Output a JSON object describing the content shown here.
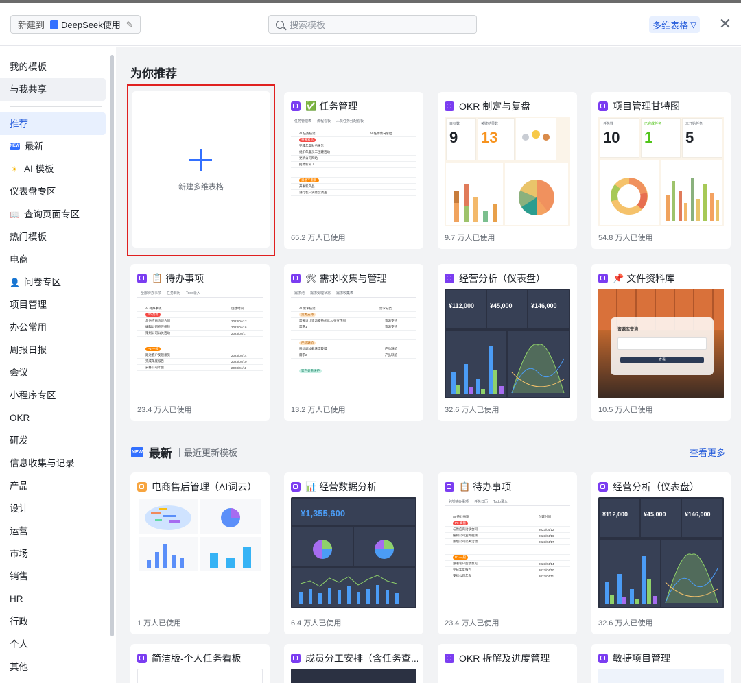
{
  "header": {
    "new_to_label": "新建到",
    "doc_name": "DeepSeek使用",
    "search_placeholder": "搜索模板",
    "filter_label": "多维表格"
  },
  "sidebar": {
    "top_items": [
      "我的模板",
      "与我共享"
    ],
    "items": [
      {
        "label": "推荐",
        "icon": ""
      },
      {
        "label": "最新",
        "icon": "new-badge-icon"
      },
      {
        "label": "AI 模板",
        "icon": "sparkle-icon"
      },
      {
        "label": "仪表盘专区",
        "icon": ""
      },
      {
        "label": "查询页面专区",
        "icon": "book-icon"
      },
      {
        "label": "热门模板",
        "icon": ""
      },
      {
        "label": "电商",
        "icon": ""
      },
      {
        "label": "问卷专区",
        "icon": "person-icon"
      },
      {
        "label": "项目管理",
        "icon": ""
      },
      {
        "label": "办公常用",
        "icon": ""
      },
      {
        "label": "周报日报",
        "icon": ""
      },
      {
        "label": "会议",
        "icon": ""
      },
      {
        "label": "小程序专区",
        "icon": ""
      },
      {
        "label": "OKR",
        "icon": ""
      },
      {
        "label": "研发",
        "icon": ""
      },
      {
        "label": "信息收集与记录",
        "icon": ""
      },
      {
        "label": "产品",
        "icon": ""
      },
      {
        "label": "设计",
        "icon": ""
      },
      {
        "label": "运营",
        "icon": ""
      },
      {
        "label": "市场",
        "icon": ""
      },
      {
        "label": "销售",
        "icon": ""
      },
      {
        "label": "HR",
        "icon": ""
      },
      {
        "label": "行政",
        "icon": ""
      },
      {
        "label": "个人",
        "icon": ""
      },
      {
        "label": "其他",
        "icon": ""
      }
    ]
  },
  "recommend": {
    "title": "为你推荐",
    "new_label": "新建多维表格",
    "cards": [
      {
        "title": "任务管理",
        "emoji": "✅",
        "usage": "65.2 万人已使用"
      },
      {
        "title": "OKR 制定与复盘",
        "emoji": "",
        "usage": "9.7 万人已使用"
      },
      {
        "title": "项目管理甘特图",
        "emoji": "",
        "usage": "54.8 万人已使用"
      },
      {
        "title": "待办事项",
        "emoji": "📋",
        "usage": "23.4 万人已使用"
      },
      {
        "title": "需求收集与管理",
        "emoji": "🛠",
        "usage": "13.2 万人已使用"
      },
      {
        "title": "经营分析（仪表盘）",
        "emoji": "",
        "usage": "32.6 万人已使用"
      },
      {
        "title": "文件资料库",
        "emoji": "📌",
        "usage": "10.5 万人已使用"
      }
    ]
  },
  "latest": {
    "title": "最新",
    "badge": "NEW",
    "subtitle": "最近更新模板",
    "more": "查看更多",
    "cards": [
      {
        "title": "电商售后管理（AI词云）",
        "emoji": "",
        "usage": "1 万人已使用"
      },
      {
        "title": "经营数据分析",
        "emoji": "📊",
        "usage": "6.4 万人已使用"
      },
      {
        "title": "待办事项",
        "emoji": "📋",
        "usage": "23.4 万人已使用"
      },
      {
        "title": "经营分析（仪表盘）",
        "emoji": "",
        "usage": "32.6 万人已使用"
      }
    ],
    "row3": [
      {
        "title": "简洁版-个人任务看板"
      },
      {
        "title": "成员分工安排（含任务查..."
      },
      {
        "title": "OKR 拆解及进度管理"
      },
      {
        "title": "敏捷项目管理"
      }
    ]
  },
  "previews": {
    "task_tabs": [
      "任务管理表",
      "流程看板",
      "人员任务分配看板"
    ],
    "task_col1": "AI 任务描述",
    "task_col2": "AI 任务情况总结",
    "task_group1": "重要紧急",
    "task_group2": "紧急不重要",
    "task_rows1": [
      "完成年度财务报告",
      "组织年度员工团建活动",
      "更新公司网站",
      "招聘新员工"
    ],
    "task_rows2": [
      "开发新产品",
      "进行客户满意度调查"
    ],
    "okr_stats": [
      {
        "label": "目标数",
        "value": "9"
      },
      {
        "label": "关键结果数",
        "value": "13"
      }
    ],
    "gantt_stats": [
      {
        "label": "任务数",
        "value": "10"
      },
      {
        "label": "已完成任务",
        "value": "1"
      },
      {
        "label": "未开始任务",
        "value": "5"
      }
    ],
    "todo_tabs": [
      "全部待办事项",
      "任务日历",
      "Todo录入"
    ],
    "todo_col1": "AI 待办事项",
    "todo_col2": "创建时间",
    "todo_group1": "P0-高优",
    "todo_group2": "P1-一般",
    "todo_rows1": [
      [
        "与供应商洽谈合同",
        "2023/04/12"
      ],
      [
        "编辑公司宣传视频",
        "2023/04/16"
      ],
      [
        "策划公司公关活动",
        "2023/04/17"
      ]
    ],
    "todo_rows2": [
      [
        "跟进客户反馈意见",
        "2023/04/14"
      ],
      [
        "完成年度报告",
        "2023/04/10"
      ],
      [
        "安排公司年会",
        "2023/04/11"
      ]
    ],
    "req_tabs": [
      "需求池",
      "需求受理状态",
      "需求收集表"
    ],
    "req_col1": "AI 需求描述",
    "req_col2": "需求分类",
    "req_group1": "资源支持",
    "req_group2": "产品缺陷",
    "req_group3": "客户关系维护",
    "req_rows1": [
      [
        "需要设计资源支持优化10张宣传图",
        "资源支持"
      ],
      [
        "需求1",
        "资源支持"
      ]
    ],
    "req_rows2": [
      [
        "移动端加载速度较慢",
        "产品缺陷"
      ],
      [
        "需求2",
        "产品缺陷"
      ]
    ],
    "dash_stats": [
      "¥112,000",
      "¥45,000",
      "¥146,000"
    ],
    "library_title": "资源库查询",
    "library_btn": "查看",
    "biz_total": "¥1,355,600"
  }
}
